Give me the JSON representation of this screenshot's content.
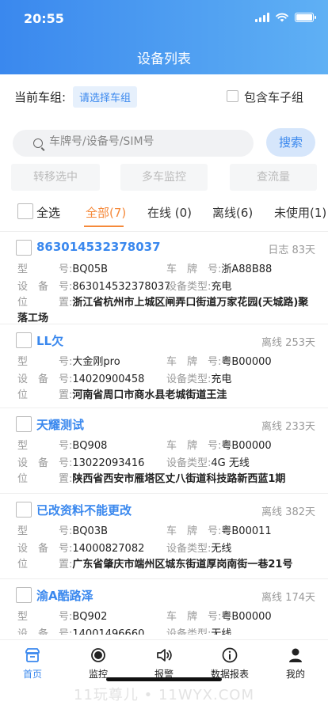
{
  "status_bar": {
    "time": "20:55"
  },
  "header": {
    "title": "设备列表"
  },
  "group": {
    "label": "当前车组:",
    "select": "请选择车组",
    "include_sub": "包含车子组"
  },
  "search": {
    "placeholder": "车牌号/设备号/SIM号",
    "button": "搜索"
  },
  "actions": [
    "转移选中",
    "多车监控",
    "查流量"
  ],
  "tabs": {
    "select_all": "全选",
    "items": [
      "全部(7)",
      "在线 (0)",
      "离线(6)",
      "未使用(1)"
    ],
    "active": 0
  },
  "labels": {
    "type": "型　　　号:",
    "plate": "车　牌　号:",
    "device_no": "设　备　号:",
    "device_type": "设备类型:",
    "position": "位　　　置:"
  },
  "devices": [
    {
      "title": "863014532378037",
      "status": "日志 83天",
      "model": "BQ05B",
      "plate": "浙A88B88",
      "device_no": "863014532378037",
      "device_type": "充电",
      "position": "浙江省杭州市上城区闸弄口街道万家花园(天城路)聚落工场"
    },
    {
      "title": "LL欠",
      "status": "离线 253天",
      "model": "大金刚pro",
      "plate": "粤B00000",
      "device_no": "14020900458",
      "device_type": "充电",
      "position": "河南省周口市商水县老城街道王洼"
    },
    {
      "title": "天耀测试",
      "status": "离线 233天",
      "model": "BQ908",
      "plate": "粤B00000",
      "device_no": "13022093416",
      "device_type": "4G 无线",
      "position": "陕西省西安市雁塔区丈八街道科技路新西蓝1期"
    },
    {
      "title": "已改资料不能更改",
      "status": "离线 382天",
      "model": "BQ03B",
      "plate": "粤B00011",
      "device_no": "14000827082",
      "device_type": "无线",
      "position": "广东省肇庆市端州区城东街道厚岗南街一巷21号"
    },
    {
      "title": "渝A酷路泽",
      "status": "离线 174天",
      "model": "BQ902",
      "plate": "粤B00000",
      "device_no": "14001496660",
      "device_type": "无线",
      "position": ""
    }
  ],
  "tabbar": [
    {
      "label": "首页",
      "icon": "home-icon"
    },
    {
      "label": "监控",
      "icon": "monitor-icon"
    },
    {
      "label": "报警",
      "icon": "alarm-icon"
    },
    {
      "label": "数据报表",
      "icon": "report-icon"
    },
    {
      "label": "我的",
      "icon": "user-icon"
    }
  ],
  "watermark": "11玩尊儿 • 11WYX.COM",
  "colors": {
    "primary": "#3a88ee",
    "accent": "#f5893a"
  }
}
